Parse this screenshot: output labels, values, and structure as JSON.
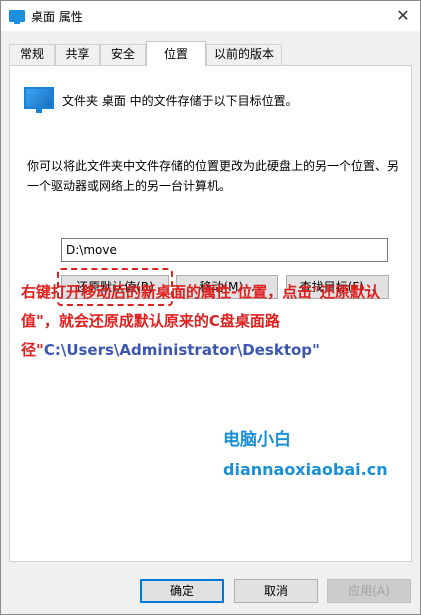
{
  "window": {
    "title": "桌面 属性",
    "close_glyph": "✕"
  },
  "tabs": [
    {
      "label": "常规",
      "active": false
    },
    {
      "label": "共享",
      "active": false
    },
    {
      "label": "安全",
      "active": false
    },
    {
      "label": "位置",
      "active": true
    },
    {
      "label": "以前的版本",
      "active": false
    }
  ],
  "location": {
    "icon": "desktop-folder-icon",
    "heading": "文件夹 桌面 中的文件存储于以下目标位置。",
    "description": "你可以将此文件夹中文件存储的位置更改为此硬盘上的另一个位置、另一个驱动器或网络上的另一台计算机。",
    "path_value": "D:\\move"
  },
  "buttons": {
    "restore": "还原默认值(R)",
    "move": "移动(M)...",
    "find_target": "查找目标(F)..."
  },
  "annotation": {
    "text": "右键打开移动后的新桌面的属性-位置，点击\"还原默认值\"，就会还原成默认原来的C盘桌面路径\"",
    "path": "C:\\Users\\Administrator\\Desktop",
    "closing_quote": "\""
  },
  "watermark": {
    "name": "电脑小白",
    "url": "diannaoxiaobai.cn"
  },
  "footer": {
    "ok": "确定",
    "cancel": "取消",
    "apply": "应用(A)"
  },
  "colors": {
    "annotation_red": "#e0201f",
    "path_blue": "#3b56b2",
    "watermark_blue": "#1a90d8",
    "accent": "#0078d7"
  }
}
